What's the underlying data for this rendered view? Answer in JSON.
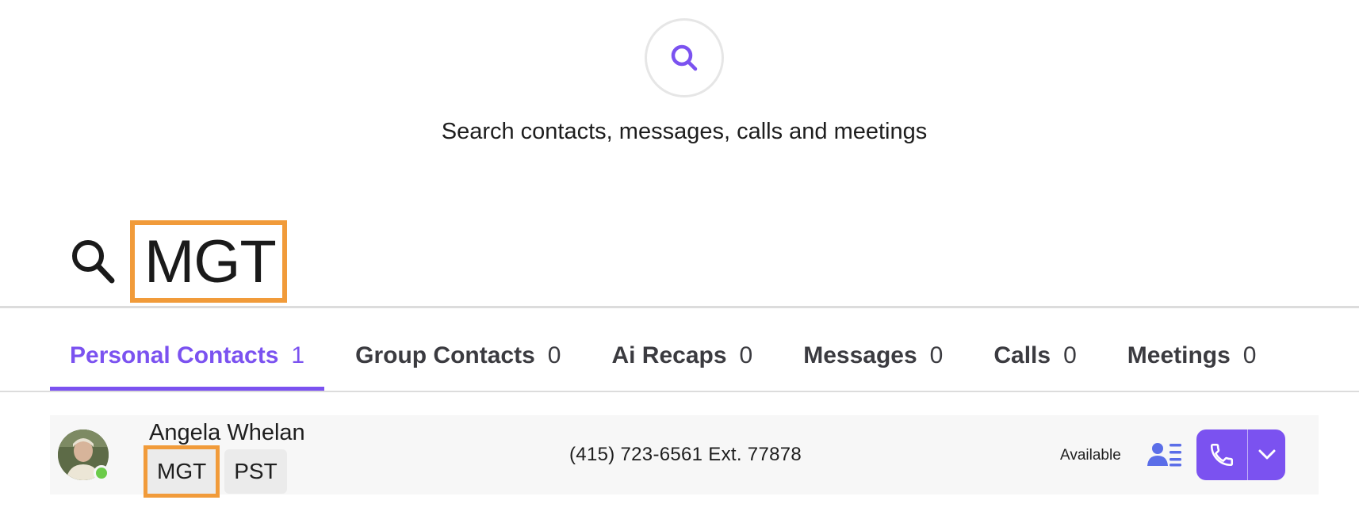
{
  "hero": {
    "icon": "search-icon",
    "text": "Search contacts, messages, calls and meetings"
  },
  "search": {
    "icon": "search-icon",
    "query": "MGT"
  },
  "tabs": [
    {
      "label": "Personal Contacts",
      "count": "1",
      "active": true
    },
    {
      "label": "Group Contacts",
      "count": "0",
      "active": false
    },
    {
      "label": "Ai Recaps",
      "count": "0",
      "active": false
    },
    {
      "label": "Messages",
      "count": "0",
      "active": false
    },
    {
      "label": "Calls",
      "count": "0",
      "active": false
    },
    {
      "label": "Meetings",
      "count": "0",
      "active": false
    }
  ],
  "contact": {
    "name": "Angela Whelan",
    "tags": [
      "MGT",
      "PST"
    ],
    "phone": "(415) 723-6561 Ext. 77878",
    "status": "Available",
    "presence_color": "#6ccb4a"
  },
  "colors": {
    "accent": "#7b52f0",
    "highlight": "#f19b3a",
    "contact_icon": "#5b6ee8"
  }
}
